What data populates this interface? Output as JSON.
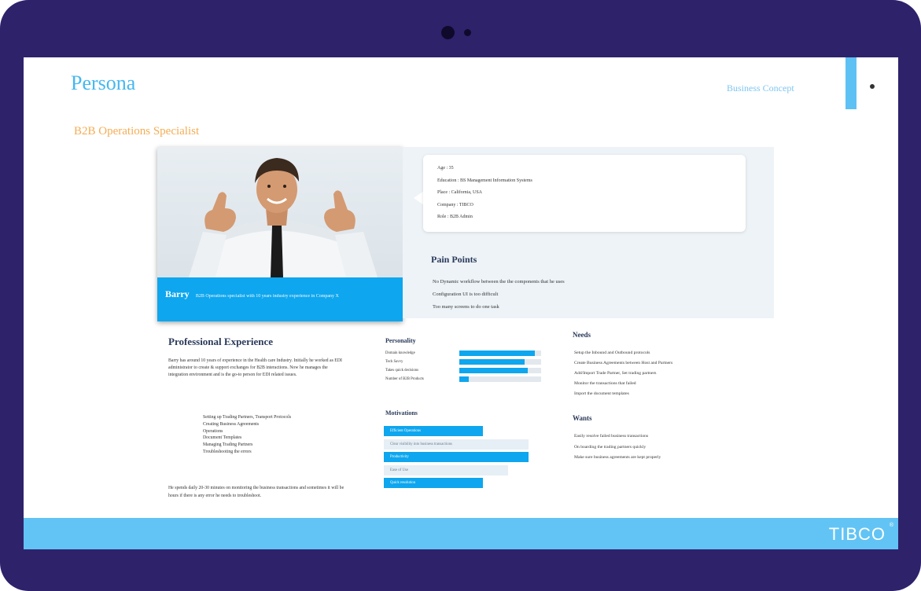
{
  "slide": {
    "title": "Persona",
    "header_link": "Business Concept",
    "role": "B2B Operations Specialist"
  },
  "profile": {
    "name": "Barry",
    "quote": "B2B Operations specialist with 10 years industry experience in Company X"
  },
  "info": {
    "lines": [
      "Age : 35",
      "Education : BS Management Information Systems",
      "Place : California, USA",
      "Company : TIBCO",
      "Role : B2B Admin"
    ]
  },
  "pain_points": {
    "title": "Pain Points",
    "items": [
      "No Dynamic workflow between the the components that he uses",
      "Configuration UI is too difficult",
      "Too many screens to do one task"
    ]
  },
  "professional": {
    "title": "Professional Experience",
    "paragraph": "Barry has around 10 years of experience in the Health care Industry. Initially he worked as EDI administrator to create & support exchanges for B2B interactions. Now he manages the integration environment and is the go-to person for EDI related issues.",
    "list": [
      "Setting up Trading Partners, Transport Protocols",
      "Creating Business Agreements",
      "Operations",
      "Document Templates",
      "Managing Trading Partners",
      "Troubleshooting the errors"
    ],
    "paragraph2": "He spends daily 20-30 minutes on monitoring the business transactions and sometimes it will be hours if there is any error he needs to troubleshoot."
  },
  "personality": {
    "title": "Personality",
    "traits": [
      {
        "label": "Domain knowledge",
        "value": 0.92
      },
      {
        "label": "Tech Savvy",
        "value": 0.8
      },
      {
        "label": "Takes quick decisions",
        "value": 0.84
      },
      {
        "label": "Number of B2B Products",
        "value": 0.12
      }
    ]
  },
  "motivations": {
    "title": "Motivations",
    "items": [
      {
        "label": "Efficient Operations",
        "state": "on"
      },
      {
        "label": "Clear visibility into business transactions",
        "state": "off"
      },
      {
        "label": "Productivity",
        "state": "on"
      },
      {
        "label": "Ease of Use",
        "state": "off"
      },
      {
        "label": "Quick resolution",
        "state": "on"
      }
    ]
  },
  "needs": {
    "title": "Needs",
    "items": [
      "Setup the Inbound and Outbound protocols",
      "Create Business Agreements between Host and Partners",
      "Add/Import Trade Partner, Set trading partners",
      "Monitor the transactions that failed",
      "Import the document templates"
    ]
  },
  "wants": {
    "title": "Wants",
    "items": [
      "Easily resolve failed business transactions",
      "On boarding the trading partners quickly",
      "Make sure business agreements are kept properly"
    ]
  },
  "footer": {
    "logo": "TIBCO",
    "logo_mark": "®"
  },
  "colors": {
    "frame": "#2e226b",
    "accent": "#0ea6ee",
    "title_blue": "#45b7f0",
    "role_orange": "#f3ad55",
    "footer": "#62c4f4"
  }
}
